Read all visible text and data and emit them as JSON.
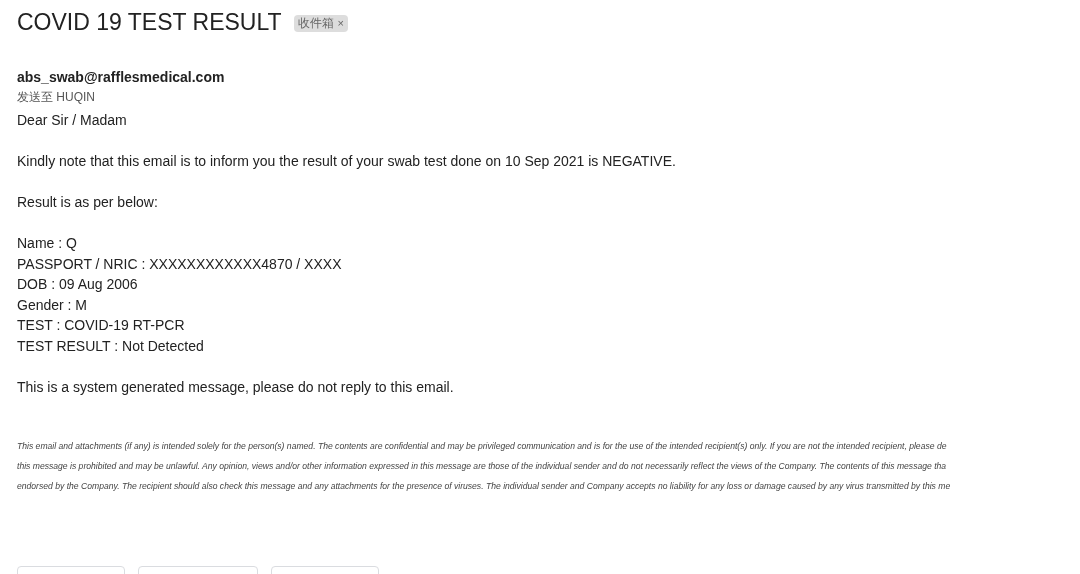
{
  "subject": "COVID 19 TEST RESULT",
  "label": {
    "text": "收件箱",
    "remove": "×"
  },
  "sender": "abs_swab@rafflesmedical.com",
  "recipient": "发送至 HUQIN",
  "body": [
    {
      "lines": [
        "Dear Sir / Madam"
      ]
    },
    {
      "lines": [
        "Kindly note that this email is to inform you the result of your swab test done on 10 Sep 2021 is NEGATIVE."
      ]
    },
    {
      "lines": [
        "Result is as per below:"
      ]
    },
    {
      "lines": [
        "Name : Q",
        "PASSPORT / NRIC : XXXXXXXXXXXX4870 / XXXX",
        "DOB : 09 Aug 2006",
        "Gender : M",
        "TEST : COVID-19 RT-PCR",
        "TEST RESULT : Not Detected"
      ]
    },
    {
      "lines": [
        "This is a system generated message, please do not reply to this email."
      ]
    }
  ],
  "disclaimer": [
    "This email and attachments (if any) is intended solely for the person(s) named. The contents are confidential and may be privileged communication and is for the use of the intended recipient(s) only. If you are not the intended recipient, please de",
    "this message is prohibited and may be unlawful. Any opinion, views and/or other information expressed in this message are those of the individual sender and do not necessarily reflect the views of the Company. The contents of this message tha",
    "endorsed by the Company. The recipient should also check this message and any attachments for the presence of viruses. The individual sender and Company accepts no liability for any loss or damage caused by any virus transmitted by this me"
  ],
  "actions": [
    {
      "kind": "button"
    },
    {
      "kind": "button"
    },
    {
      "kind": "button"
    }
  ]
}
